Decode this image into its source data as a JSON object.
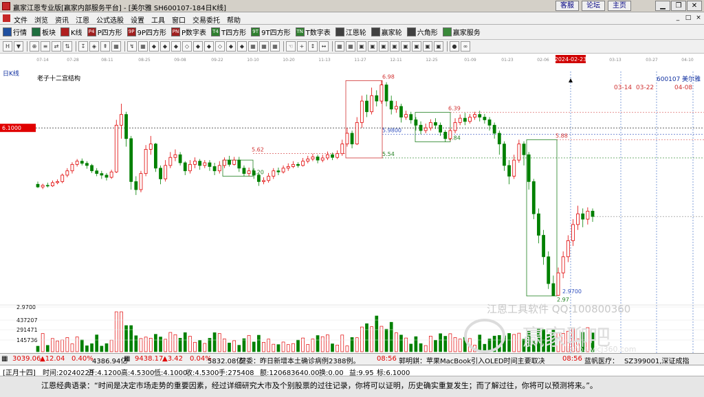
{
  "window": {
    "title": "赢家江恩专业版[赢家内部服务平台] - [美尔雅  SH600107-184日K线]",
    "links": [
      "客服",
      "论坛",
      "主页"
    ],
    "controls": [
      "▁",
      "❐",
      "✕"
    ]
  },
  "menu": {
    "items": [
      "文件",
      "浏览",
      "资讯",
      "江恩",
      "公式选股",
      "设置",
      "工具",
      "窗口",
      "交易委托",
      "帮助"
    ],
    "mdi_controls": [
      "_",
      "□",
      "×"
    ]
  },
  "toolbar": {
    "items": [
      {
        "label": "行情",
        "icon": "grid-icon",
        "color": "#2050a0"
      },
      {
        "label": "板块",
        "icon": "blocks-icon",
        "color": "#1f6f3f"
      },
      {
        "label": "K线",
        "icon": "candles-icon",
        "color": "#b02020"
      },
      {
        "label": "P四方形",
        "icon": "P4",
        "color": "#a02020"
      },
      {
        "label": "9P四方形",
        "icon": "9P",
        "color": "#a02020"
      },
      {
        "label": "P数字表",
        "icon": "PN",
        "color": "#a02020"
      },
      {
        "label": "T四方形",
        "icon": "T4",
        "color": "#2f7f2f"
      },
      {
        "label": "9T四方形",
        "icon": "9T",
        "color": "#2f7f2f"
      },
      {
        "label": "T数字表",
        "icon": "TN",
        "color": "#2f7f2f"
      },
      {
        "label": "江恩轮",
        "icon": "wheel-icon",
        "color": "#404040"
      },
      {
        "label": "赢家轮",
        "icon": "wheel-icon",
        "color": "#404040"
      },
      {
        "label": "六角形",
        "icon": "hexagon-icon",
        "color": "#404040"
      },
      {
        "label": "赢家服务",
        "icon": "dollar-icon",
        "color": "#3a8a3a"
      }
    ]
  },
  "drawing_tools": [
    "H",
    "▼",
    "⊕",
    "≡",
    "⇄",
    "⇅",
    "↧",
    "◈",
    "⇞",
    "▦",
    "↯",
    "▦",
    "◆",
    "◆",
    "◆",
    "◇",
    "◆",
    "◆",
    "◇",
    "◆",
    "◆",
    "▦",
    "▦",
    "▦",
    "☜",
    "+",
    "↕",
    "↔",
    "▦",
    "▦",
    "▣",
    "▣",
    "▣",
    "▣",
    "▣",
    "▣",
    "▣",
    "▣",
    "●",
    "∞"
  ],
  "date_axis": {
    "labels": [
      "07-14",
      "07-28",
      "08-11",
      "08-25",
      "09-08",
      "09-22",
      "10-10",
      "10-20",
      "11-13",
      "11-27",
      "12-11",
      "12-25",
      "01-09",
      "01-23",
      "02-06",
      "2024-02-23",
      "03-13",
      "03-27",
      "04-10"
    ]
  },
  "chart": {
    "period": "日K线",
    "study": "老子十二宫结构",
    "stock_code": "600107",
    "stock_name": "美尔雅",
    "left_price_tag": "6.1000",
    "future_dates": [
      "03-14",
      "03-22",
      "04-08"
    ],
    "levels": [
      "6.98",
      "5.9800",
      "6.39",
      "5.84",
      "5.62",
      "5.20",
      "5.54",
      "5.88",
      "2.9700",
      "2.97"
    ],
    "volume_axis": [
      "2.9700",
      "437207",
      "291471",
      "145736"
    ],
    "watermark": "江恩工具软件 QQ:100800360",
    "watermark2": "赢家聊吧",
    "watermark3": "liaoba.vicj360.com"
  },
  "chart_data": {
    "type": "candlestick",
    "title": "老子十二宫结构",
    "ylabel": "",
    "ylim": [
      2.7,
      7.1
    ],
    "series": [
      {
        "values": [
          [
            5.05,
            5.0,
            5.1,
            4.98
          ],
          [
            5.0,
            5.03,
            5.06,
            4.96
          ],
          [
            5.03,
            5.02,
            5.08,
            4.99
          ],
          [
            5.02,
            5.08,
            5.12,
            5.0
          ],
          [
            5.08,
            5.1,
            5.14,
            5.05
          ],
          [
            5.1,
            5.22,
            5.25,
            5.07
          ],
          [
            5.22,
            5.3,
            5.35,
            5.18
          ],
          [
            5.3,
            5.42,
            5.46,
            5.25
          ],
          [
            5.42,
            5.48,
            5.52,
            5.38
          ],
          [
            5.48,
            5.44,
            5.53,
            5.4
          ],
          [
            5.44,
            5.4,
            5.48,
            5.34
          ],
          [
            5.4,
            5.3,
            5.43,
            5.26
          ],
          [
            5.3,
            5.25,
            5.35,
            5.2
          ],
          [
            5.25,
            5.22,
            5.3,
            5.15
          ],
          [
            5.22,
            5.18,
            5.26,
            5.12
          ],
          [
            5.18,
            5.28,
            5.32,
            5.15
          ],
          [
            5.28,
            6.15,
            6.25,
            5.26
          ],
          [
            6.15,
            6.35,
            6.55,
            5.9
          ],
          [
            6.35,
            5.9,
            6.4,
            5.75
          ],
          [
            5.9,
            5.1,
            5.95,
            4.95
          ],
          [
            5.1,
            4.95,
            5.2,
            4.85
          ],
          [
            4.95,
            5.25,
            5.3,
            4.9
          ],
          [
            5.25,
            5.7,
            5.78,
            5.2
          ],
          [
            5.7,
            5.8,
            5.95,
            5.6
          ],
          [
            5.8,
            5.35,
            5.82,
            5.28
          ],
          [
            5.35,
            5.15,
            5.4,
            5.05
          ],
          [
            5.15,
            5.4,
            5.5,
            5.1
          ],
          [
            5.4,
            5.55,
            5.65,
            5.35
          ],
          [
            5.55,
            5.6,
            5.7,
            5.48
          ],
          [
            5.6,
            5.45,
            5.65,
            5.4
          ],
          [
            5.45,
            5.3,
            5.48,
            5.22
          ],
          [
            5.3,
            5.42,
            5.5,
            5.25
          ],
          [
            5.42,
            5.48,
            5.55,
            5.35
          ],
          [
            5.48,
            5.4,
            5.52,
            5.32
          ],
          [
            5.4,
            5.45,
            5.5,
            5.35
          ],
          [
            5.45,
            5.38,
            5.5,
            5.3
          ],
          [
            5.38,
            5.3,
            5.45,
            5.22
          ],
          [
            5.3,
            5.4,
            5.48,
            5.25
          ],
          [
            5.4,
            5.5,
            5.55,
            5.35
          ],
          [
            5.5,
            5.42,
            5.58,
            5.38
          ],
          [
            5.42,
            5.5,
            5.56,
            5.4
          ],
          [
            5.5,
            5.35,
            5.56,
            5.28
          ],
          [
            5.35,
            5.25,
            5.4,
            5.2
          ],
          [
            5.25,
            5.3,
            5.36,
            5.2
          ],
          [
            5.3,
            5.22,
            5.35,
            5.15
          ],
          [
            5.22,
            5.1,
            5.25,
            5.02
          ],
          [
            5.1,
            5.12,
            5.18,
            5.05
          ],
          [
            5.12,
            5.2,
            5.26,
            5.08
          ],
          [
            5.2,
            5.3,
            5.35,
            5.15
          ],
          [
            5.3,
            5.28,
            5.36,
            5.22
          ],
          [
            5.28,
            5.35,
            5.4,
            5.25
          ],
          [
            5.35,
            5.38,
            5.44,
            5.3
          ],
          [
            5.38,
            5.42,
            5.48,
            5.35
          ],
          [
            5.42,
            5.4,
            5.46,
            5.36
          ],
          [
            5.4,
            5.48,
            5.54,
            5.38
          ],
          [
            5.48,
            5.52,
            5.58,
            5.44
          ],
          [
            5.52,
            5.56,
            5.62,
            5.48
          ],
          [
            5.56,
            5.5,
            5.6,
            5.44
          ],
          [
            5.5,
            5.54,
            5.6,
            5.46
          ],
          [
            5.54,
            5.6,
            5.66,
            5.5
          ],
          [
            5.6,
            5.55,
            5.64,
            5.5
          ],
          [
            5.55,
            5.62,
            5.68,
            5.52
          ],
          [
            5.62,
            5.8,
            5.88,
            5.58
          ],
          [
            5.8,
            6.0,
            6.1,
            5.75
          ],
          [
            6.0,
            5.8,
            6.05,
            5.72
          ],
          [
            5.8,
            6.2,
            6.3,
            5.78
          ],
          [
            6.2,
            6.6,
            6.7,
            6.1
          ],
          [
            6.6,
            6.4,
            6.72,
            6.3
          ],
          [
            6.4,
            6.7,
            6.85,
            6.35
          ],
          [
            6.7,
            6.6,
            6.8,
            6.5
          ],
          [
            6.6,
            6.9,
            6.98,
            6.55
          ],
          [
            6.9,
            6.6,
            6.95,
            6.5
          ],
          [
            6.6,
            6.45,
            6.7,
            6.35
          ],
          [
            6.45,
            6.5,
            6.6,
            6.38
          ],
          [
            6.5,
            6.3,
            6.55,
            6.2
          ],
          [
            6.3,
            6.35,
            6.42,
            6.25
          ],
          [
            6.35,
            6.25,
            6.4,
            6.18
          ],
          [
            6.25,
            6.15,
            6.3,
            6.05
          ],
          [
            6.15,
            6.05,
            6.22,
            5.98
          ],
          [
            6.05,
            6.1,
            6.18,
            6.0
          ],
          [
            6.1,
            6.2,
            6.26,
            6.05
          ],
          [
            6.2,
            6.15,
            6.28,
            6.08
          ],
          [
            6.15,
            6.02,
            6.2,
            5.95
          ],
          [
            6.02,
            5.9,
            6.06,
            5.84
          ],
          [
            5.9,
            6.05,
            6.1,
            5.86
          ],
          [
            6.05,
            6.2,
            6.28,
            6.0
          ],
          [
            6.2,
            6.28,
            6.35,
            6.15
          ],
          [
            6.28,
            6.22,
            6.38,
            6.15
          ],
          [
            6.22,
            6.3,
            6.36,
            6.18
          ],
          [
            6.3,
            6.35,
            6.4,
            6.25
          ],
          [
            6.35,
            6.3,
            6.42,
            6.22
          ],
          [
            6.3,
            6.25,
            6.36,
            6.18
          ],
          [
            6.25,
            6.15,
            6.3,
            6.05
          ],
          [
            6.15,
            6.0,
            6.2,
            5.9
          ],
          [
            6.0,
            5.8,
            6.05,
            5.6
          ],
          [
            5.8,
            5.4,
            5.85,
            5.3
          ],
          [
            5.4,
            5.2,
            5.5,
            5.05
          ],
          [
            5.2,
            5.5,
            5.6,
            5.15
          ],
          [
            5.5,
            5.8,
            5.88,
            5.45
          ],
          [
            5.8,
            5.6,
            5.85,
            5.4
          ],
          [
            5.6,
            5.1,
            5.65,
            4.95
          ],
          [
            5.1,
            4.5,
            5.15,
            4.4
          ],
          [
            4.5,
            4.1,
            4.6,
            3.95
          ],
          [
            4.1,
            3.7,
            4.2,
            3.55
          ],
          [
            3.7,
            3.2,
            3.8,
            3.1
          ],
          [
            3.2,
            2.98,
            3.35,
            2.97
          ],
          [
            2.98,
            3.4,
            3.5,
            2.97
          ],
          [
            3.4,
            3.7,
            3.8,
            3.3
          ],
          [
            3.7,
            4.0,
            4.1,
            3.6
          ],
          [
            4.0,
            4.3,
            4.4,
            3.9
          ],
          [
            4.3,
            4.5,
            4.65,
            4.2
          ],
          [
            4.5,
            4.4,
            4.6,
            4.25
          ],
          [
            4.4,
            4.55,
            4.62,
            4.3
          ],
          [
            4.55,
            4.45,
            4.6,
            4.35
          ]
        ]
      }
    ]
  },
  "index_bar": {
    "sh_value": "3039.06",
    "sh_change": "▲12.04",
    "sh_pct": "0.40%",
    "sh_amount": "4386.94亿",
    "sz_value": "9438.17",
    "sz_change": "▲3.42",
    "sz_pct": "0.04%",
    "sz_amount": "5832.08亿",
    "news1": "健委：昨日新增本土确诊病例2388例。",
    "news_time1": "08:56",
    "news2": "郭明錤：苹果MacBook引入OLED时间主要取决",
    "news_time2": "08:56",
    "news3": "蓝帆医疗：",
    "sz_index": "SZ399001,深证成指"
  },
  "status": {
    "date_tag": "[正月十四]",
    "time": "时间:20240223",
    "open": "开:4.1200",
    "high": "高:4.5300",
    "low": "低:4.1000",
    "close": "收:4.5300",
    "hands": "手:275408",
    "amount": "额:120683640.00",
    "turnover": "换:0.00",
    "pe": "益:9.95",
    "mark": "标:6.1000"
  },
  "quote": "江恩经典语录：“时间是决定市场走势的重要因素，经过详细研究大市及个别股票的过往记录，你将可以证明，历史确实重复发生；而了解过往，你将可以预测将来。”。"
}
